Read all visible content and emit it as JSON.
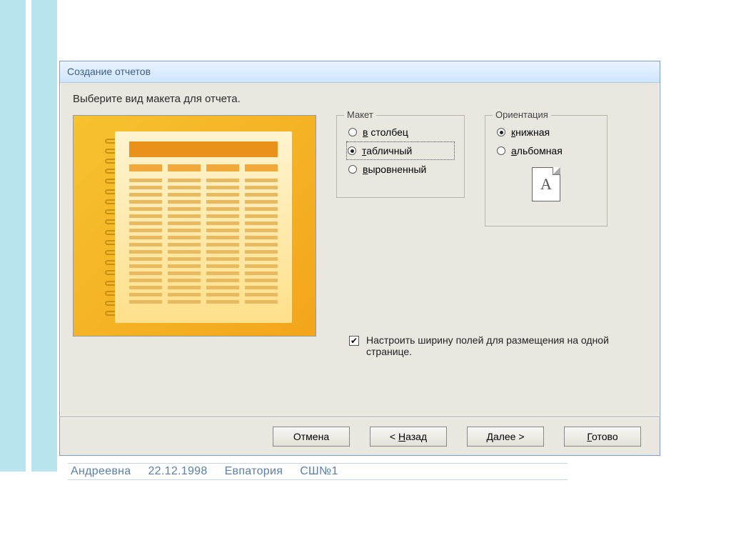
{
  "dialog": {
    "title": "Создание отчетов",
    "instruction": "Выберите вид макета для отчета."
  },
  "layout_group": {
    "legend": "Макет",
    "options": {
      "columnar": "в столбец",
      "tabular": "табличный",
      "justified": "выровненный"
    },
    "selected": "tabular"
  },
  "orientation_group": {
    "legend": "Ориентация",
    "options": {
      "portrait": "книжная",
      "landscape": "альбомная"
    },
    "selected": "portrait",
    "page_glyph": "A"
  },
  "fit_width": {
    "checked": true,
    "label": "Настроить ширину полей для размещения на одной странице."
  },
  "buttons": {
    "cancel": "Отмена",
    "back_full": "< Назад",
    "next_full": "Далее >",
    "finish": "Готово"
  },
  "background_row": {
    "c1": "Андреевна",
    "c2": "22.12.1998",
    "c3": "Евпатория",
    "c4": "СШ№1"
  }
}
